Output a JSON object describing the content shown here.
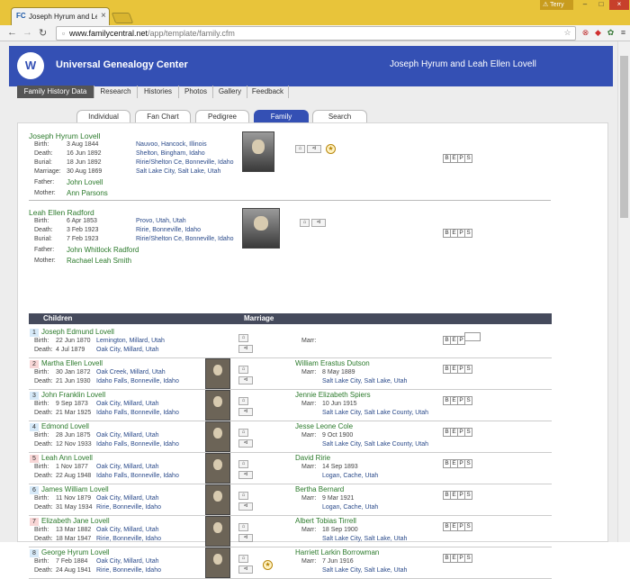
{
  "browser": {
    "tab_title": "Joseph Hyrum and Leah E",
    "favicon": "FC",
    "user": "Terry",
    "url_domain": "www.familycentral.net",
    "url_path": "/app/template/family.cfm"
  },
  "header": {
    "title": "Universal Genealogy Center",
    "family_name": "Joseph Hyrum and Leah Ellen Lovell",
    "logo_text": "W"
  },
  "menu": [
    "Family History Data",
    "Research",
    "Histories",
    "Photos",
    "Gallery",
    "Feedback"
  ],
  "page_tabs": [
    "Individual",
    "Fan Chart",
    "Pedigree",
    "Family",
    "Search"
  ],
  "labels": {
    "birth": "Birth:",
    "death": "Death:",
    "burial": "Burial:",
    "marriage": "Marriage:",
    "father": "Father:",
    "mother": "Mother:",
    "marr": "Marr:",
    "children": "Children",
    "marriage_col": "Marriage"
  },
  "beps": [
    "B",
    "E",
    "P",
    "S"
  ],
  "husband": {
    "name": "Joseph Hyrum Lovell",
    "birth": "3 Aug 1844",
    "birth_place": "Nauvoo, Hancock, Illinois",
    "death": "16 Jun 1892",
    "death_place": "Shelton, Bingham, Idaho",
    "burial": "18 Jun 1892",
    "burial_place": "Ririe/Shelton Ce, Bonneville, Idaho",
    "marriage": "30 Aug 1869",
    "marriage_place": "Salt Lake City, Salt Lake, Utah",
    "father": "John Lovell",
    "mother": "Ann Parsons"
  },
  "wife": {
    "name": "Leah Ellen Radford",
    "birth": "6 Apr 1853",
    "birth_place": "Provo, Utah, Utah",
    "death": "3 Feb 1923",
    "death_place": "Ririe, Bonneville, Idaho",
    "burial": "7 Feb 1923",
    "burial_place": "Ririe/Shelton Ce, Bonneville, Idaho",
    "father": "John Whitlock Radford",
    "mother": "Rachael Leah Smith"
  },
  "children": [
    {
      "num": "1",
      "sex": "m",
      "name": "Joseph Edmund Lovell",
      "birth": "22 Jun 1870",
      "birth_place": "Lemington, Millard, Utah",
      "death": "4 Jul 1879",
      "death_place": "Oak City, Millard, Utah",
      "spouse": "",
      "marr": "",
      "marr_place": "",
      "photo": false
    },
    {
      "num": "2",
      "sex": "f",
      "name": "Martha Ellen Lovell",
      "birth": "30 Jan 1872",
      "birth_place": "Oak Creek, Millard, Utah",
      "death": "21 Jun 1930",
      "death_place": "Idaho Falls, Bonneville, Idaho",
      "spouse": "William Erastus Dutson",
      "marr": "8 May 1889",
      "marr_place": "Salt Lake City, Salt Lake, Utah",
      "photo": true
    },
    {
      "num": "3",
      "sex": "m",
      "name": "John Franklin Lovell",
      "birth": "9 Sep 1873",
      "birth_place": "Oak City, Millard, Utah",
      "death": "21 Mar 1925",
      "death_place": "Idaho Falls, Bonneville, Idaho",
      "spouse": "Jennie Elizabeth Spiers",
      "marr": "10 Jun 1915",
      "marr_place": "Salt Lake City, Salt Lake County, Utah",
      "photo": true
    },
    {
      "num": "4",
      "sex": "m",
      "name": "Edmond Lovell",
      "birth": "28 Jun 1875",
      "birth_place": "Oak City, Millard, Utah",
      "death": "12 Nov 1933",
      "death_place": "Idaho Falls, Bonneville, Idaho",
      "spouse": "Jesse Leone Cole",
      "marr": "9 Oct 1900",
      "marr_place": "Salt Lake City, Salt Lake County, Utah",
      "photo": true
    },
    {
      "num": "5",
      "sex": "f",
      "name": "Leah Ann Lovell",
      "birth": "1 Nov 1877",
      "birth_place": "Oak City, Millard, Utah",
      "death": "22 Aug 1948",
      "death_place": "Idaho Falls, Bonneville, Idaho",
      "spouse": "David Ririe",
      "marr": "14 Sep 1893",
      "marr_place": "Logan, Cache, Utah",
      "photo": true
    },
    {
      "num": "6",
      "sex": "m",
      "name": "James William Lovell",
      "birth": "11 Nov 1879",
      "birth_place": "Oak City, Millard, Utah",
      "death": "31 May 1934",
      "death_place": "Ririe, Bonneville, Idaho",
      "spouse": "Bertha Bernard",
      "marr": "9 Mar 1921",
      "marr_place": "Logan, Cache, Utah",
      "photo": true
    },
    {
      "num": "7",
      "sex": "f",
      "name": "Elizabeth Jane Lovell",
      "birth": "13 Mar 1882",
      "birth_place": "Oak City, Millard, Utah",
      "death": "18 Mar 1947",
      "death_place": "Ririe, Bonneville, Idaho",
      "spouse": "Albert Tobias Tirrell",
      "marr": "18 Sep 1900",
      "marr_place": "Salt Lake City, Salt Lake, Utah",
      "photo": true
    },
    {
      "num": "8",
      "sex": "m",
      "name": "George Hyrum Lovell",
      "birth": "7 Feb 1884",
      "birth_place": "Oak City, Millard, Utah",
      "death": "24 Aug 1941",
      "death_place": "Ririe, Bonneville, Idaho",
      "spouse": "Harriett Larkin Borrowman",
      "marr": "7 Jun 1916",
      "marr_place": "Salt Lake City, Salt Lake, Utah",
      "photo": true
    }
  ]
}
